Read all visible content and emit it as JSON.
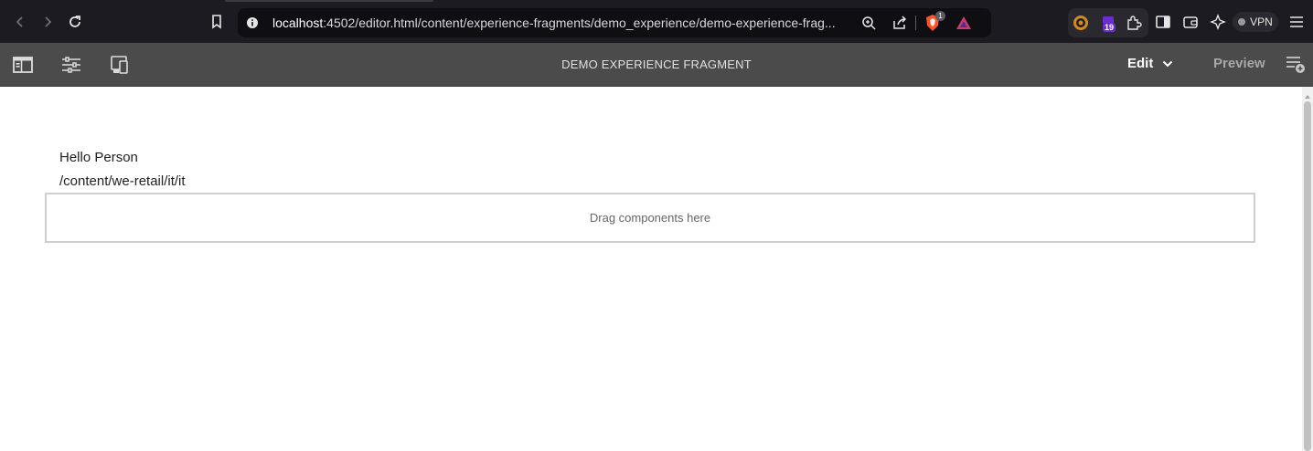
{
  "browser": {
    "url_host": "localhost",
    "url_path": ":4502/editor.html/content/experience-fragments/demo_experience/demo-experience-frag...",
    "brave_badge": "1",
    "extension_badge": "19",
    "vpn_label": "VPN",
    "icons": [
      "back-icon",
      "forward-icon",
      "reload-icon",
      "bookmark-icon",
      "site-info-icon",
      "zoom-icon",
      "share-icon",
      "brave-shield-icon",
      "brave-rewards-icon",
      "extension-icon",
      "extensions-puzzle-icon",
      "sidebar-icon",
      "wallet-icon",
      "leo-ai-icon",
      "menu-icon"
    ]
  },
  "editor": {
    "title": "DEMO EXPERIENCE FRAGMENT",
    "mode_edit": "Edit",
    "mode_preview": "Preview",
    "icons": [
      "side-panel-icon",
      "page-properties-icon",
      "emulator-icon",
      "annotations-icon"
    ]
  },
  "content": {
    "greeting": "Hello Person",
    "path": "/content/we-retail/it/it",
    "dropzone_label": "Drag components here"
  },
  "colors": {
    "browser_bg": "#1c1b22",
    "toolbar_bg": "#4b4b4b",
    "brave_orange": "#fb542b",
    "extension_purple": "#6b2fd1"
  }
}
